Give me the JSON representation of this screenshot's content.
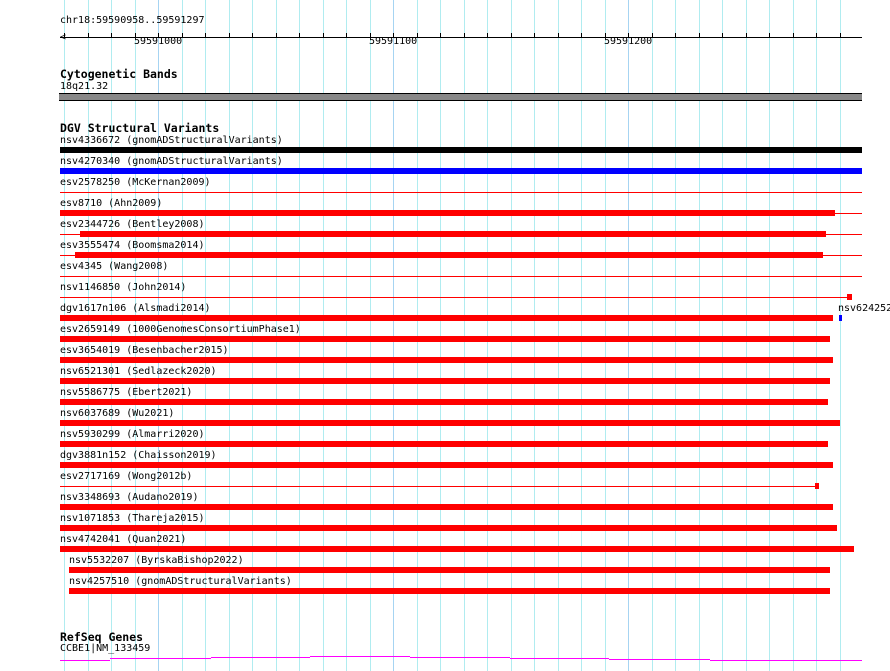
{
  "ruler": {
    "location": "chr18:59590958..59591297",
    "tick_labels": [
      "59591000",
      "59591100",
      "59591200"
    ]
  },
  "cytoband": {
    "title": "Cytogenetic Bands",
    "band": "18q21.32"
  },
  "dgv": {
    "title": "DGV Structural Variants",
    "rows": [
      {
        "label": "nsv4336672 (gnomADStructuralVariants)",
        "color": "#000000"
      },
      {
        "label": "nsv4270340 (gnomADStructuralVariants)",
        "color": "#0000ff"
      },
      {
        "label": "esv2578250 (McKernan2009)",
        "color": "#ff0000"
      },
      {
        "label": "esv8710 (Ahn2009)",
        "color": "#ff0000"
      },
      {
        "label": "esv2344726 (Bentley2008)",
        "color": "#ff0000"
      },
      {
        "label": "esv3555474 (Boomsma2014)",
        "color": "#ff0000"
      },
      {
        "label": "esv4345 (Wang2008)",
        "color": "#ff0000"
      },
      {
        "label": "nsv1146850 (John2014)",
        "color": "#ff0000"
      },
      {
        "label": "dgv1617n106 (Alsmadi2014)",
        "color": "#ff0000"
      },
      {
        "label": "esv2659149 (1000GenomesConsortiumPhase1)",
        "color": "#ff0000"
      },
      {
        "label": "esv3654019 (Besenbacher2015)",
        "color": "#ff0000"
      },
      {
        "label": "nsv6521301 (Sedlazeck2020)",
        "color": "#ff0000"
      },
      {
        "label": "nsv5586775 (Ebert2021)",
        "color": "#ff0000"
      },
      {
        "label": "nsv6037689 (Wu2021)",
        "color": "#ff0000"
      },
      {
        "label": "nsv5930299 (Almarri2020)",
        "color": "#ff0000"
      },
      {
        "label": "dgv3881n152 (Chaisson2019)",
        "color": "#ff0000"
      },
      {
        "label": "esv2717169 (Wong2012b)",
        "color": "#ff0000"
      },
      {
        "label": "nsv3348693 (Audano2019)",
        "color": "#ff0000"
      },
      {
        "label": "nsv1071853 (Thareja2015)",
        "color": "#ff0000"
      },
      {
        "label": "nsv4742041 (Quan2021)",
        "color": "#ff0000"
      },
      {
        "label": "nsv5532207 (ByrskaBishop2022)",
        "color": "#ff0000"
      },
      {
        "label": "nsv4257510 (gnomADStructuralVariants)",
        "color": "#ff0000"
      }
    ],
    "extra": {
      "label": "nsv624252",
      "color": "#0000ff"
    }
  },
  "refseq": {
    "title": "RefSeq Genes",
    "gene": "CCBE1|NM_133459",
    "color": "#ff00ff"
  }
}
